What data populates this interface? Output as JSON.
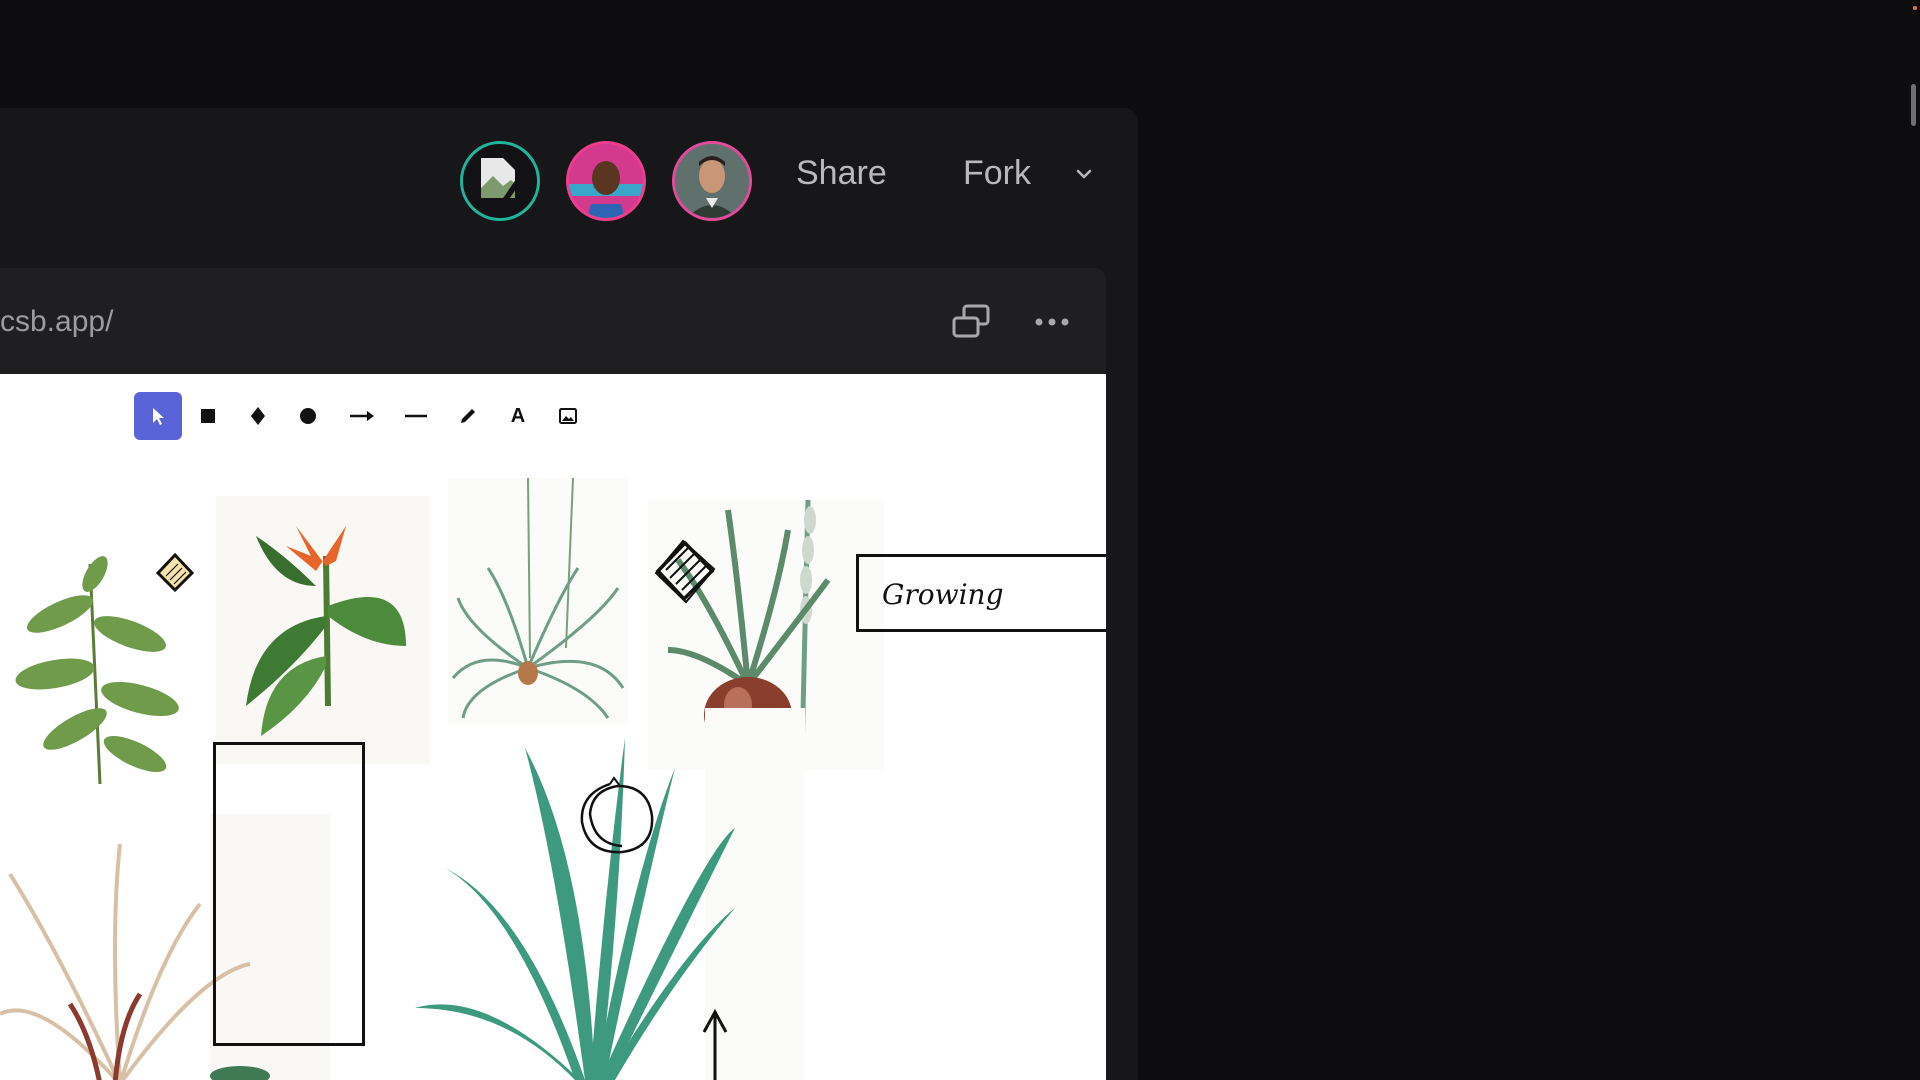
{
  "header": {
    "share_label": "Share",
    "fork_label": "Fork",
    "avatars": [
      {
        "name": "avatar-placeholder",
        "ring_color": "#1fb59a"
      },
      {
        "name": "avatar-user-2",
        "ring_color": "#ec3e8d"
      },
      {
        "name": "avatar-user-3",
        "ring_color": "#e04b9b"
      }
    ]
  },
  "preview": {
    "url": "csb.app/",
    "icons": [
      "open-in-new-window-icon",
      "more-options-icon"
    ]
  },
  "toolbar": {
    "tools": [
      {
        "name": "select-tool",
        "icon": "cursor-arrow-icon",
        "active": true
      },
      {
        "name": "rectangle-tool",
        "icon": "square-icon"
      },
      {
        "name": "diamond-tool",
        "icon": "diamond-icon"
      },
      {
        "name": "ellipse-tool",
        "icon": "circle-icon"
      },
      {
        "name": "arrow-tool",
        "icon": "arrow-right-icon"
      },
      {
        "name": "line-tool",
        "icon": "line-icon"
      },
      {
        "name": "draw-tool",
        "icon": "pencil-icon"
      },
      {
        "name": "text-tool",
        "icon": "text-icon",
        "glyph": "A"
      },
      {
        "name": "image-tool",
        "icon": "image-icon"
      }
    ]
  },
  "canvas": {
    "text_box": "Growing"
  },
  "colors": {
    "background": "#0d0d0f",
    "panel": "#171719",
    "accent": "#5b63d9"
  }
}
